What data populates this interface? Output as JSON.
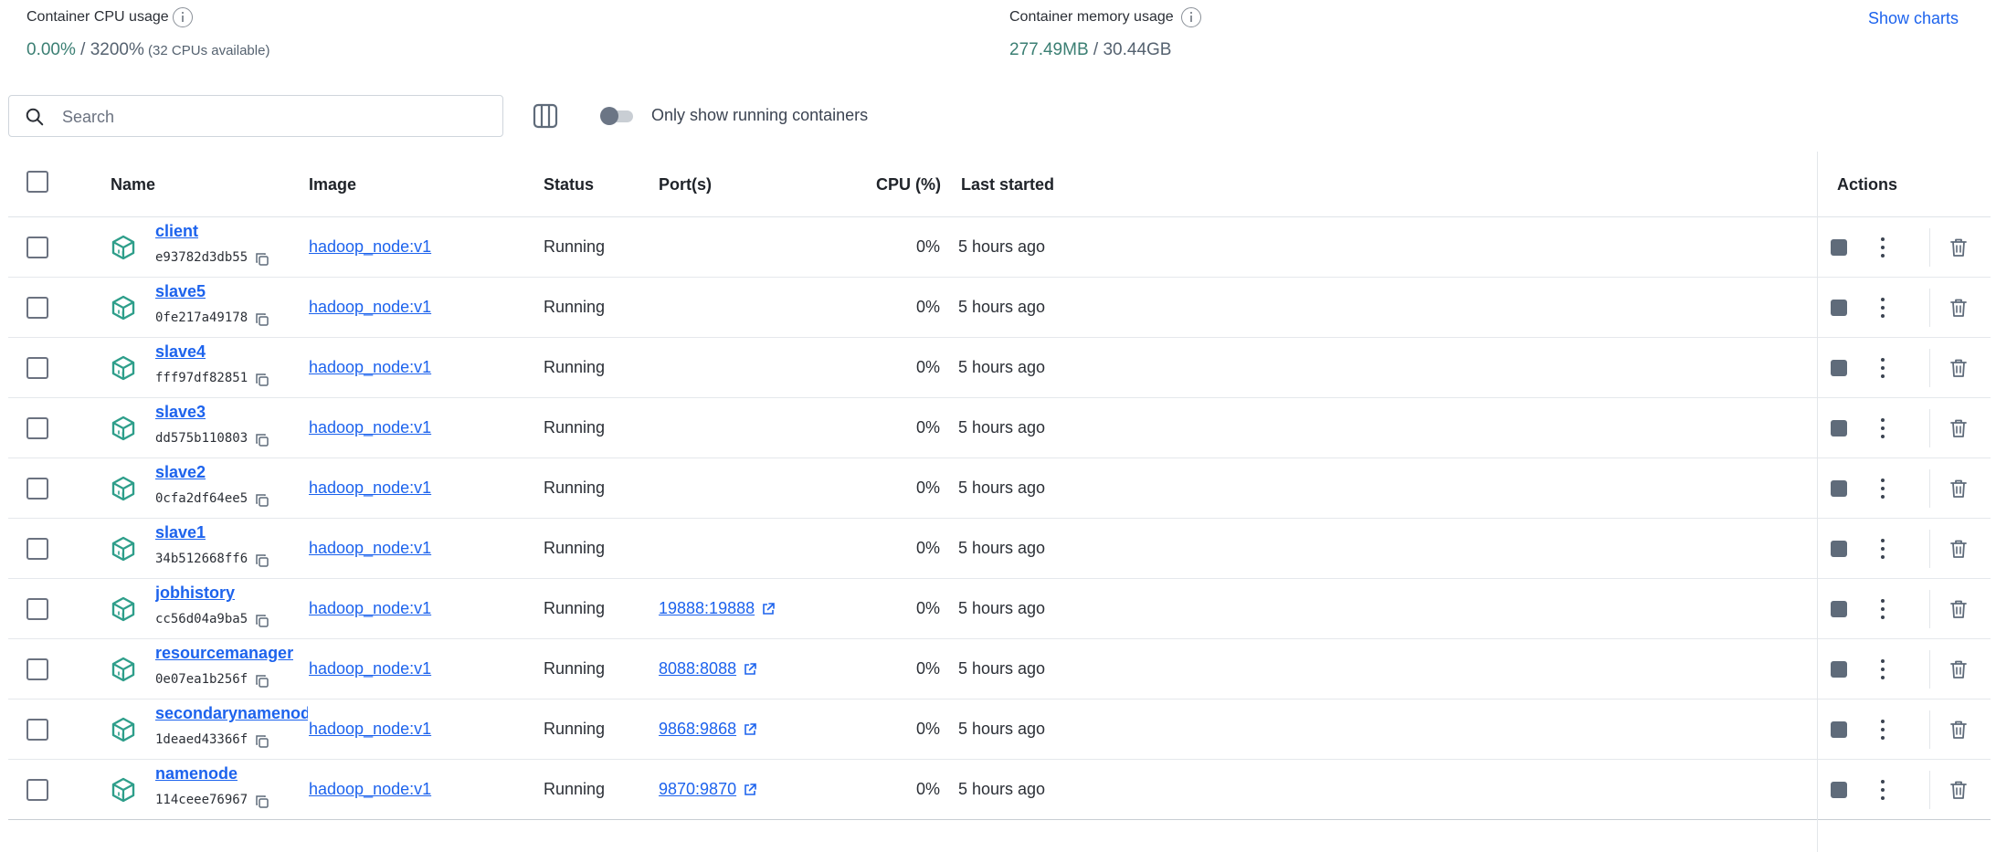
{
  "stats": {
    "cpu": {
      "title": "Container CPU usage",
      "value": "0.00%",
      "sep": " / ",
      "limit": "3200%",
      "note": " (32 CPUs available)"
    },
    "memory": {
      "title": "Container memory usage",
      "value": "277.49MB",
      "sep": " / ",
      "limit": "30.44GB"
    },
    "show_charts": "Show charts"
  },
  "search": {
    "placeholder": "Search"
  },
  "toggle": {
    "label": "Only show running containers",
    "on": false
  },
  "table": {
    "headers": {
      "name": "Name",
      "image": "Image",
      "status": "Status",
      "ports": "Port(s)",
      "cpu": "CPU (%)",
      "last_started": "Last started",
      "actions": "Actions"
    },
    "rows": [
      {
        "name": "client",
        "id": "e93782d3db55",
        "image": "hadoop_node:v1",
        "status": "Running",
        "port": "",
        "cpu": "0%",
        "last_started": "5 hours ago"
      },
      {
        "name": "slave5",
        "id": "0fe217a49178",
        "image": "hadoop_node:v1",
        "status": "Running",
        "port": "",
        "cpu": "0%",
        "last_started": "5 hours ago"
      },
      {
        "name": "slave4",
        "id": "fff97df82851",
        "image": "hadoop_node:v1",
        "status": "Running",
        "port": "",
        "cpu": "0%",
        "last_started": "5 hours ago"
      },
      {
        "name": "slave3",
        "id": "dd575b110803",
        "image": "hadoop_node:v1",
        "status": "Running",
        "port": "",
        "cpu": "0%",
        "last_started": "5 hours ago"
      },
      {
        "name": "slave2",
        "id": "0cfa2df64ee5",
        "image": "hadoop_node:v1",
        "status": "Running",
        "port": "",
        "cpu": "0%",
        "last_started": "5 hours ago"
      },
      {
        "name": "slave1",
        "id": "34b512668ff6",
        "image": "hadoop_node:v1",
        "status": "Running",
        "port": "",
        "cpu": "0%",
        "last_started": "5 hours ago"
      },
      {
        "name": "jobhistory",
        "id": "cc56d04a9ba5",
        "image": "hadoop_node:v1",
        "status": "Running",
        "port": "19888:19888",
        "cpu": "0%",
        "last_started": "5 hours ago"
      },
      {
        "name": "resourcemanager",
        "id": "0e07ea1b256f",
        "image": "hadoop_node:v1",
        "status": "Running",
        "port": "8088:8088",
        "cpu": "0%",
        "last_started": "5 hours ago"
      },
      {
        "name": "secondarynamenode",
        "id": "1deaed43366f",
        "image": "hadoop_node:v1",
        "status": "Running",
        "port": "9868:9868",
        "cpu": "0%",
        "last_started": "5 hours ago"
      },
      {
        "name": "namenode",
        "id": "114ceee76967",
        "image": "hadoop_node:v1",
        "status": "Running",
        "port": "9870:9870",
        "cpu": "0%",
        "last_started": "5 hours ago"
      }
    ]
  },
  "icons": {
    "search": "search-icon",
    "columns": "columns-icon",
    "container": "container-cube-icon",
    "copy": "copy-icon",
    "external": "external-link-icon",
    "stop": "stop-icon",
    "more": "more-vertical-icon",
    "delete": "trash-icon"
  },
  "colors": {
    "accent": "#1d63ed",
    "stat_value": "#3b7f73",
    "container_icon": "#2e9e8a"
  }
}
